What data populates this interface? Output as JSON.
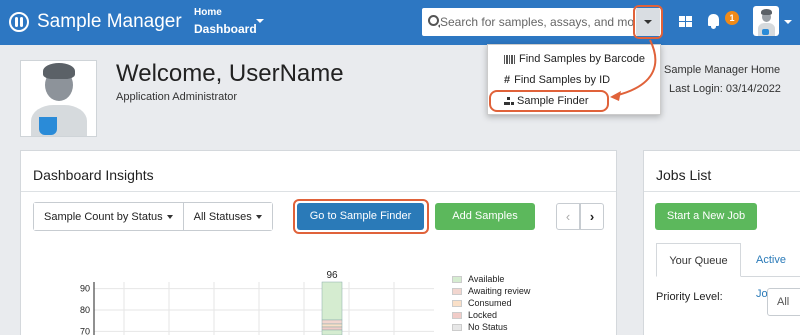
{
  "app": {
    "name": "Sample Manager"
  },
  "nav": {
    "menu_small": "Home",
    "menu_big": "Dashboard",
    "notification_count": "1"
  },
  "search": {
    "placeholder": "Search for samples, assays, and more..."
  },
  "dropdown": {
    "items": [
      {
        "label": "Find Samples by Barcode",
        "icon": "barcode-icon"
      },
      {
        "label": "Find Samples by ID",
        "icon": "hash-icon"
      },
      {
        "label": "Sample Finder",
        "icon": "sitemap-icon"
      }
    ]
  },
  "welcome": {
    "heading": "Welcome, UserName",
    "role": "Application Administrator",
    "home_link": "Sample Manager Home",
    "last_login": "Last Login: 03/14/2022"
  },
  "insights": {
    "title": "Dashboard Insights",
    "filter_metric": "Sample Count by Status",
    "filter_status": "All Statuses",
    "primary_button": "Go to Sample Finder",
    "add_button": "Add Samples",
    "prev": "‹",
    "next": "›"
  },
  "jobs": {
    "title": "Jobs List",
    "new_job_button": "Start a New Job",
    "tab_active": "Your Queue",
    "tab_inactive": "Active Jo",
    "priority_label": "Priority Level:",
    "priority_value": "All"
  },
  "colors": {
    "nav_blue": "#2d77c2",
    "primary": "#2a7ab8",
    "success": "#5cb85c",
    "highlight": "#e0623a",
    "badge": "#f08a18"
  },
  "chart_data": {
    "type": "bar",
    "yticks": [
      90,
      80,
      70
    ],
    "ylim": [
      65,
      95
    ],
    "bar_label": "96",
    "series": [
      {
        "name": "Available",
        "color": "#d5ecd0"
      },
      {
        "name": "Awaiting review",
        "color": "#f2d6cf"
      },
      {
        "name": "Consumed",
        "color": "#fae0c8"
      },
      {
        "name": "Locked",
        "color": "#f1ccc8"
      },
      {
        "name": "No Status",
        "color": "#e7e7e7"
      }
    ]
  }
}
